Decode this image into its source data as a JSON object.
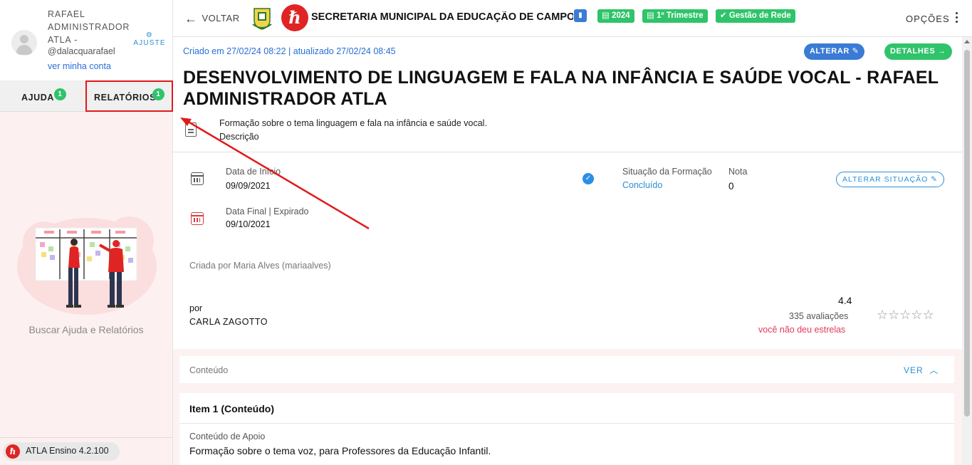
{
  "user": {
    "name": "RAFAEL ADMINISTRADOR ATLA -",
    "handle": "@dalacquarafael",
    "account_link": "ver minha conta",
    "settings_label": "AJUSTE"
  },
  "sidebar": {
    "tabs": [
      {
        "label": "AJUDA",
        "badge": "1"
      },
      {
        "label": "RELATÓRIOS",
        "badge": "1"
      }
    ],
    "help_text": "Buscar Ajuda e Relatórios",
    "version": "ATLA Ensino 4.2.100"
  },
  "header": {
    "back_label": "VOLTAR",
    "secretaria": "SECRETARIA MUNICIPAL DA EDUCAÇÃO DE CAMPO",
    "chips": {
      "year": "2024",
      "trimestre": "1º Trimestre",
      "gestao": "Gestão de Rede"
    },
    "options_label": "OPÇÕES"
  },
  "record": {
    "created": "Criado em 27/02/24 08:22 | atualizado 27/02/24 08:45",
    "alter_label": "ALTERAR",
    "details_label": "DETALHES",
    "title": "DESENVOLVIMENTO DE LINGUAGEM E FALA NA INFÂNCIA E SAÚDE VOCAL - RAFAEL ADMINISTRADOR ATLA",
    "description": "Formação sobre o tema linguagem e fala na infância e saúde vocal.",
    "description_label": "Descrição",
    "start_label": "Data de Início",
    "start_value": "09/09/2021",
    "end_label": "Data Final | Expirado",
    "end_value": "09/10/2021",
    "situation_label": "Situação da Formação",
    "situation_value": "Concluído",
    "grade_label": "Nota",
    "grade_value": "0",
    "alter_situation_label": "ALTERAR SITUAÇÃO",
    "created_by": "Criada por Maria Alves (mariaalves)",
    "by_label": "por",
    "author": "CARLA ZAGOTTO",
    "rating": "4.4",
    "rating_count": "335 avaliações",
    "rating_none": "você não deu estrelas",
    "stars": 0
  },
  "content": {
    "section_label": "Conteúdo",
    "toggle_label": "VER",
    "item_title": "Item 1 (Conteúdo)",
    "support_label": "Conteúdo de Apoio",
    "support_value": "Formação sobre o tema voz, para Professores da Educação Infantil."
  },
  "colors": {
    "accent_blue": "#3a7bd5",
    "accent_green": "#2fc46a",
    "brand_red": "#e02424",
    "annotation_red": "#e01a1a"
  }
}
